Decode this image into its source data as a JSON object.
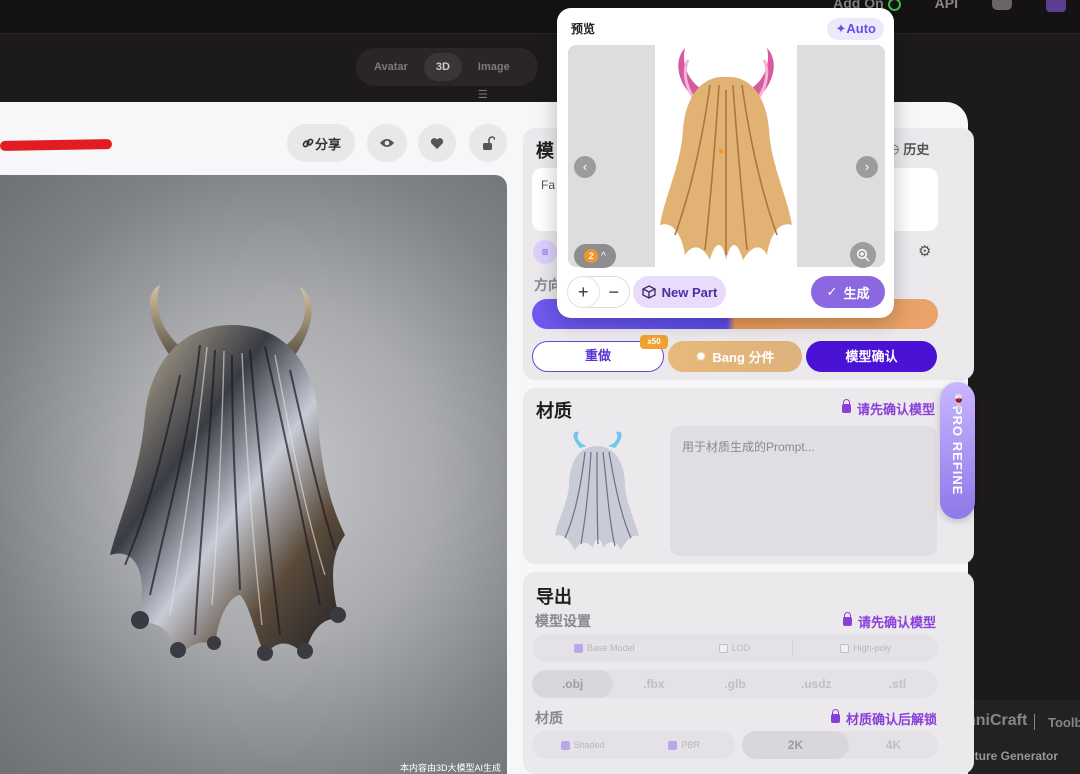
{
  "topnav": {
    "addon": "Add On",
    "api": "API"
  },
  "mode_tabs": [
    {
      "label": "Avatar",
      "active": false
    },
    {
      "label": "3D",
      "active": true
    },
    {
      "label": "Image",
      "active": false,
      "icon": "menu-icon"
    }
  ],
  "toolbar": {
    "share_label": "分享"
  },
  "viewport": {
    "caption": "本内容由3D大模型AI生成"
  },
  "model_card": {
    "title_partial": "模",
    "history_label": "历史",
    "prompt_partial": "Fa",
    "direction_partial": "方向"
  },
  "actions": {
    "redo_label": "重做",
    "x50_badge": "x50",
    "bang_label": "Bang 分件",
    "confirm_label": "模型确认"
  },
  "material": {
    "title": "材质",
    "lock_label": "请先确认模型",
    "prompt_placeholder": "用于材质生成的Prompt..."
  },
  "export": {
    "title": "导出",
    "model_settings_label": "模型设置",
    "model_settings_lock": "请先确认模型",
    "options": [
      {
        "label": "Base Model",
        "checked": true
      },
      {
        "label": "LOD",
        "checked": false
      },
      {
        "label": "High-poly",
        "checked": false
      }
    ],
    "formats": [
      ".obj",
      ".fbx",
      ".glb",
      ".usdz",
      ".stl"
    ],
    "selected_format": ".obj",
    "material_label": "材质",
    "material_lock": "材质确认后解锁",
    "material_options": [
      {
        "label": "Shaded",
        "checked": true
      },
      {
        "label": "PBR",
        "checked": true
      }
    ],
    "resolutions": [
      "2K",
      "4K"
    ],
    "selected_resolution": "2K"
  },
  "pro_refine": {
    "label": "PRO REFINE"
  },
  "background_app": {
    "brand": "nniCraft",
    "toolbar": "Toolb",
    "texture": "xture Generator"
  },
  "preview_popup": {
    "title": "预览",
    "auto_label": "Auto",
    "part_count": "2",
    "new_part_label": "New Part",
    "generate_label": "生成"
  },
  "colors": {
    "accent_purple": "#4912d4",
    "lock_purple": "#8b3fd9",
    "bang_gold": "#e7b97a",
    "badge_orange": "#f0a233"
  }
}
